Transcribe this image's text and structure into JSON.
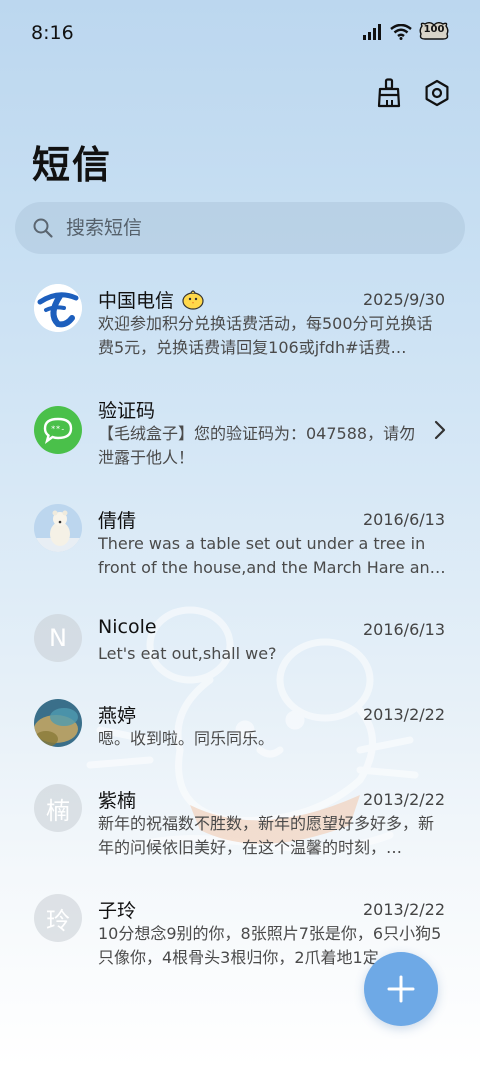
{
  "status_bar": {
    "time": "8:16",
    "battery": "100"
  },
  "page_title": "短信",
  "search": {
    "placeholder": "搜索短信"
  },
  "conversations": [
    {
      "name": "中国电信",
      "date": "2025/9/30",
      "preview": "欢迎参加积分兑换话费活动，每500分可兑换话费5元，兑换话费请回复106或jfdh#话费…",
      "avatar": "china-telecom-logo"
    },
    {
      "name": "验证码",
      "date": "",
      "preview": "【毛绒盒子】您的验证码为：047588，请勿泄露于他人！",
      "avatar": "chat-bubble-icon"
    },
    {
      "name": "倩倩",
      "date": "2016/6/13",
      "preview": "There was a table set out under a tree in front of the house,and the March Hare an…",
      "avatar": "polar-bear-photo"
    },
    {
      "name": "Nicole",
      "date": "2016/6/13",
      "preview": "Let's eat out,shall we?",
      "avatar_letter": "N"
    },
    {
      "name": "燕婷",
      "date": "2013/2/22",
      "preview": "嗯。收到啦。同乐同乐。",
      "avatar": "ocean-photo"
    },
    {
      "name": "紫楠",
      "date": "2013/2/22",
      "preview": "新年的祝福数不胜数，新年的愿望好多好多，新年的问候依旧美好，在这个温馨的时刻，…",
      "avatar_letter": "楠"
    },
    {
      "name": "子玲",
      "date": "2013/2/22",
      "preview": "10分想念9别的你，8张照片7张是你，6只小狗5只像你，4根骨头3根归你，2爪着地1定…",
      "avatar_letter": "玲"
    }
  ],
  "colors": {
    "fab": "#6ea9e6",
    "telecom_blue": "#1d5fbd",
    "chat_green": "#4ac04a"
  }
}
